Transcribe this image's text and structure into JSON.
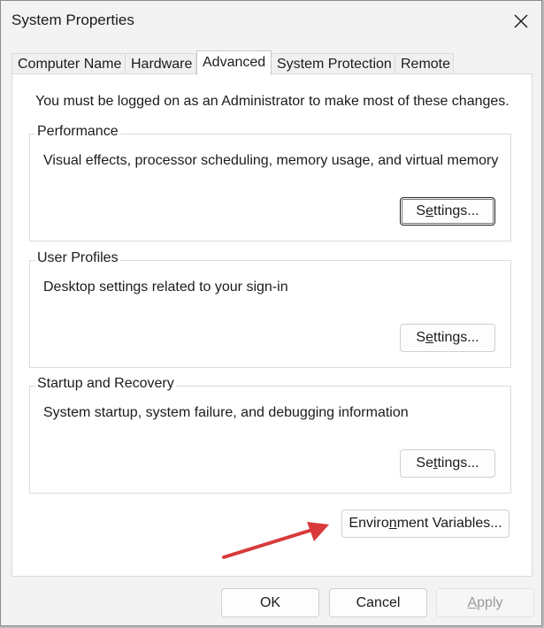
{
  "window": {
    "title": "System Properties"
  },
  "tabs": [
    {
      "label": "Computer Name",
      "active": false
    },
    {
      "label": "Hardware",
      "active": false
    },
    {
      "label": "Advanced",
      "active": true
    },
    {
      "label": "System Protection",
      "active": false
    },
    {
      "label": "Remote",
      "active": false
    }
  ],
  "advanced": {
    "admin_note": "You must be logged on as an Administrator to make most of these changes.",
    "performance": {
      "legend": "Performance",
      "description": "Visual effects, processor scheduling, memory usage, and virtual memory",
      "button": {
        "pre": "S",
        "underline": "e",
        "post": "ttings..."
      }
    },
    "user_profiles": {
      "legend": "User Profiles",
      "description": "Desktop settings related to your sign-in",
      "button": {
        "pre": "S",
        "underline": "e",
        "post": "ttings..."
      }
    },
    "startup_recovery": {
      "legend": "Startup and Recovery",
      "description": "System startup, system failure, and debugging information",
      "button": {
        "pre": "Se",
        "underline": "t",
        "post": "tings..."
      }
    },
    "env_button": {
      "pre": "Enviro",
      "underline": "n",
      "post": "ment Variables..."
    }
  },
  "footer": {
    "ok": "OK",
    "cancel": "Cancel",
    "apply": {
      "pre": "",
      "underline": "A",
      "post": "pply"
    }
  },
  "colors": {
    "annotation_arrow": "#d9393b",
    "window_bg": "#f3f3f3",
    "panel_bg": "#ffffff"
  },
  "icons": {
    "close": "close-icon",
    "annotation": "red-arrow-annotation"
  }
}
